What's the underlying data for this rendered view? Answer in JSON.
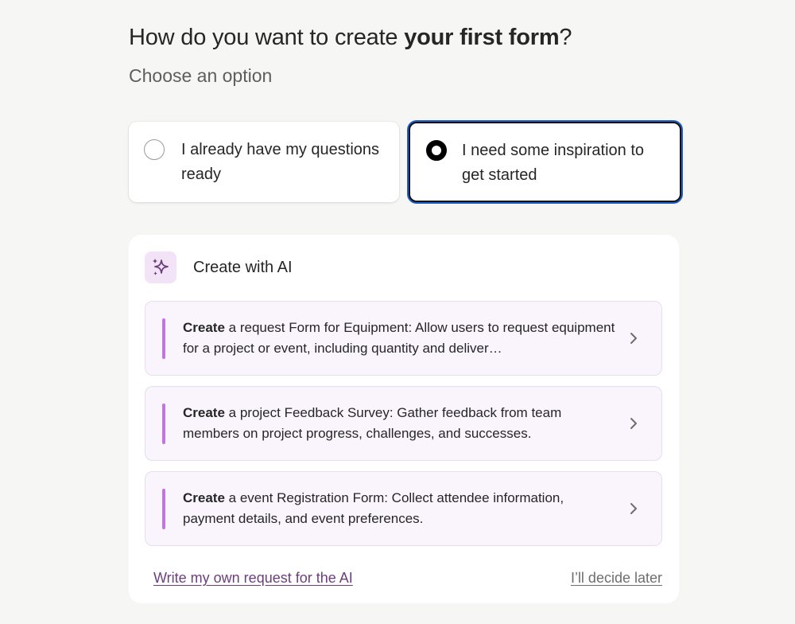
{
  "header": {
    "title_prefix": "How do you want to create ",
    "title_bold": "your first form",
    "title_suffix": "?",
    "subtitle": "Choose an option"
  },
  "options": [
    {
      "label": "I already have my questions ready",
      "selected": false
    },
    {
      "label": "I need some inspiration to get started",
      "selected": true
    }
  ],
  "ai_panel": {
    "icon": "sparkles-icon",
    "title": "Create with AI",
    "suggestions": [
      {
        "verb": "Create",
        "text": " a request Form for Equipment: Allow users to request equipment for a project or event, including quantity and deliver…"
      },
      {
        "verb": "Create",
        "text": " a project Feedback Survey: Gather feedback from team members on project progress, challenges, and successes."
      },
      {
        "verb": "Create",
        "text": " a event Registration Form: Collect attendee information, payment details, and event preferences."
      }
    ],
    "write_own_link": "Write my own request for the AI",
    "decide_later_link": "I’ll decide later"
  },
  "colors": {
    "background": "#f6f6f5",
    "accent_purple": "#c076dc",
    "link_purple": "#6b3f7a",
    "focus_blue": "#1d5fc9"
  }
}
